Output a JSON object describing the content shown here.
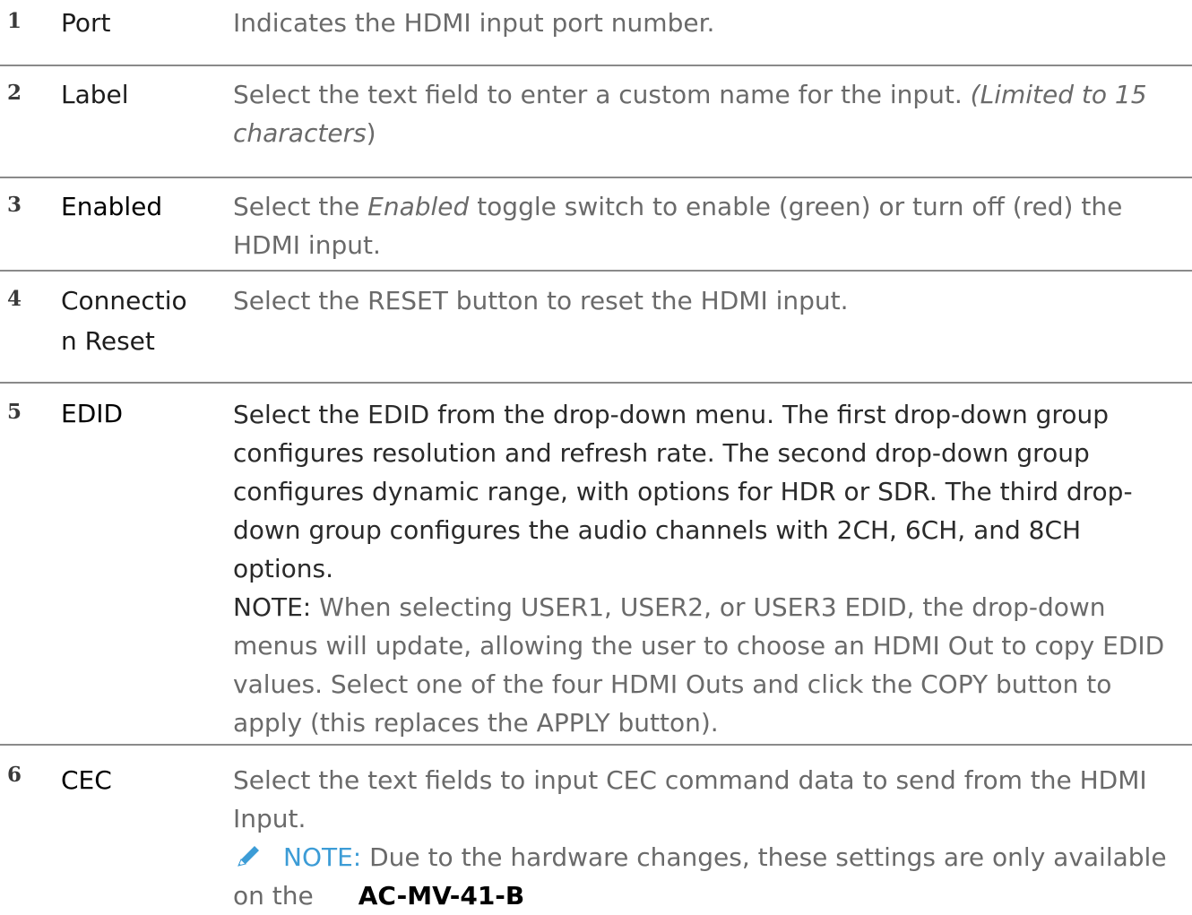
{
  "rows": [
    {
      "num": "1",
      "term": "Port",
      "desc": "Indicates the HDMI input port number."
    },
    {
      "num": "2",
      "term": "Label",
      "desc_main": "Select the text field to enter a custom name for the input. ",
      "desc_italic": "(Limited to 15 characters",
      "desc_end": ")"
    },
    {
      "num": "3",
      "term": "Enabled",
      "desc_pre": "Select the ",
      "desc_italic": "Enabled",
      "desc_post": " toggle switch to enable (green) or turn off (red) the HDMI input."
    },
    {
      "num": "4",
      "term_line1": "Connectio",
      "term_line2": "n Reset",
      "desc": "Select the RESET button to reset the HDMI input."
    },
    {
      "num": "5",
      "term": "EDID",
      "desc": "Select the EDID from the drop-down menu. The first drop-down group configures resolution and refresh rate. The second drop-down group configures dynamic range, with options for HDR or SDR. The third drop-down group configures the audio channels with 2CH, 6CH, and 8CH options.",
      "note_label": "NOTE:",
      "note_text": " When selecting USER1, USER2, or USER3 EDID, the drop-down menus will update, allowing the user to choose an HDMI Out to copy EDID values. Select one of the four HDMI Outs and click the COPY button to apply (this replaces the APPLY button)."
    },
    {
      "num": "6",
      "term": "CEC",
      "desc": "Select the text fields to input CEC command data to send from the HDMI Input.",
      "note_label": "NOTE:",
      "note_text": " Due to the hardware changes, these settings are only available on the",
      "model": "AC-MV-41-B"
    }
  ],
  "colors": {
    "divider": "#8a8a8a",
    "note_blue": "#3c9cd6",
    "desc_gray": "#6a6a6a"
  },
  "icons": {
    "note": "pencil-icon"
  }
}
